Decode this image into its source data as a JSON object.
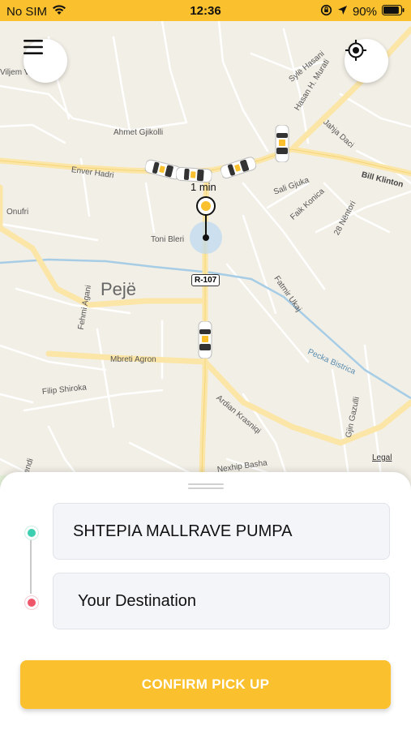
{
  "status_bar": {
    "carrier": "No SIM",
    "time": "12:36",
    "battery": "90%",
    "battery_level": 0.9
  },
  "map": {
    "city_label": "Pejë",
    "road_sign": "R-107",
    "eta_label": "1 min",
    "legal_link": "Legal",
    "streets": {
      "ahmet_gjikolli": "Ahmet Gjikolli",
      "enver_hadri": "Enver Hadri",
      "onufri": "Onufri",
      "toni_bleri": "Toni Bleri",
      "fehmi_agani": "Fehmi Agani",
      "mbreti_agron": "Mbreti Agron",
      "filip_shiroka": "Filip Shiroka",
      "nexhip_basha": "Nexhip Basha",
      "ardian_krasniqi": "Ardian Krasniqi",
      "pecka_bistrica": "Pecka Bistrica",
      "gjin_gazulli": "Gjin Gazulli",
      "fatmir_ukaj": "Fatmir Ukaj",
      "faik_konica": "Faik Konica",
      "sali_gjuka": "Sali Gjuka",
      "28_nentori": "28 Nëntori",
      "bill_klinton": "Bill Klinton",
      "jahja_daci": "Jahja Daci",
      "hasan_h_murati": "Hasan H. Murati",
      "syle_hasani": "Sylë Hasani",
      "viljem": "Viljem V",
      "mendi": "Mendi"
    }
  },
  "sheet": {
    "pickup_value": "SHTEPIA MALLRAVE PUMPA",
    "destination_placeholder": "Your Destination",
    "confirm_label": "CONFIRM PICK UP"
  },
  "colors": {
    "accent": "#fbc02d",
    "pickup_dot": "#3ccfb0",
    "destination_dot": "#f0566a"
  },
  "icons": [
    "menu-icon",
    "locate-icon",
    "wifi-icon",
    "location-arrow-icon",
    "battery-icon",
    "lock-rotation-icon",
    "taxi-icon",
    "pickup-pin-icon"
  ]
}
